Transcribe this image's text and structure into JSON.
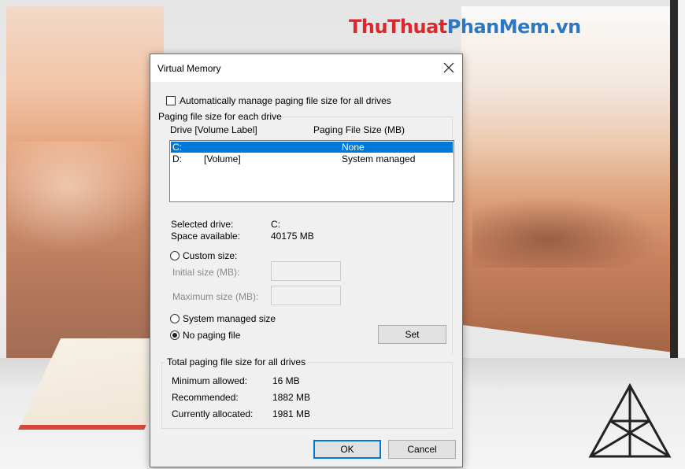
{
  "watermark": {
    "part1": "ThuThuat",
    "part2": "PhanMem.vn"
  },
  "dialog": {
    "title": "Virtual Memory",
    "auto_manage_label": "Automatically manage paging file size for all drives",
    "per_drive_group": "Paging file size for each drive",
    "columns": {
      "drive": "Drive  [Volume Label]",
      "size": "Paging File Size (MB)"
    },
    "drives": [
      {
        "drive": "C:",
        "label": "",
        "size": "None",
        "selected": true
      },
      {
        "drive": "D:",
        "label": "[Volume]",
        "size": "System managed",
        "selected": false
      }
    ],
    "selected_drive_label": "Selected drive:",
    "selected_drive_value": "C:",
    "space_available_label": "Space available:",
    "space_available_value": "40175 MB",
    "custom_size_label": "Custom size:",
    "initial_size_label": "Initial size (MB):",
    "maximum_size_label": "Maximum size (MB):",
    "system_managed_label": "System managed size",
    "no_paging_label": "No paging file",
    "set_button": "Set",
    "totals_group": "Total paging file size for all drives",
    "minimum_label": "Minimum allowed:",
    "minimum_value": "16 MB",
    "recommended_label": "Recommended:",
    "recommended_value": "1882 MB",
    "allocated_label": "Currently allocated:",
    "allocated_value": "1981 MB",
    "ok_button": "OK",
    "cancel_button": "Cancel"
  },
  "colors": {
    "selection": "#0078d7",
    "dialog_bg": "#f0f0f0",
    "watermark_red": "#e0262b",
    "watermark_blue": "#2a78c8"
  }
}
